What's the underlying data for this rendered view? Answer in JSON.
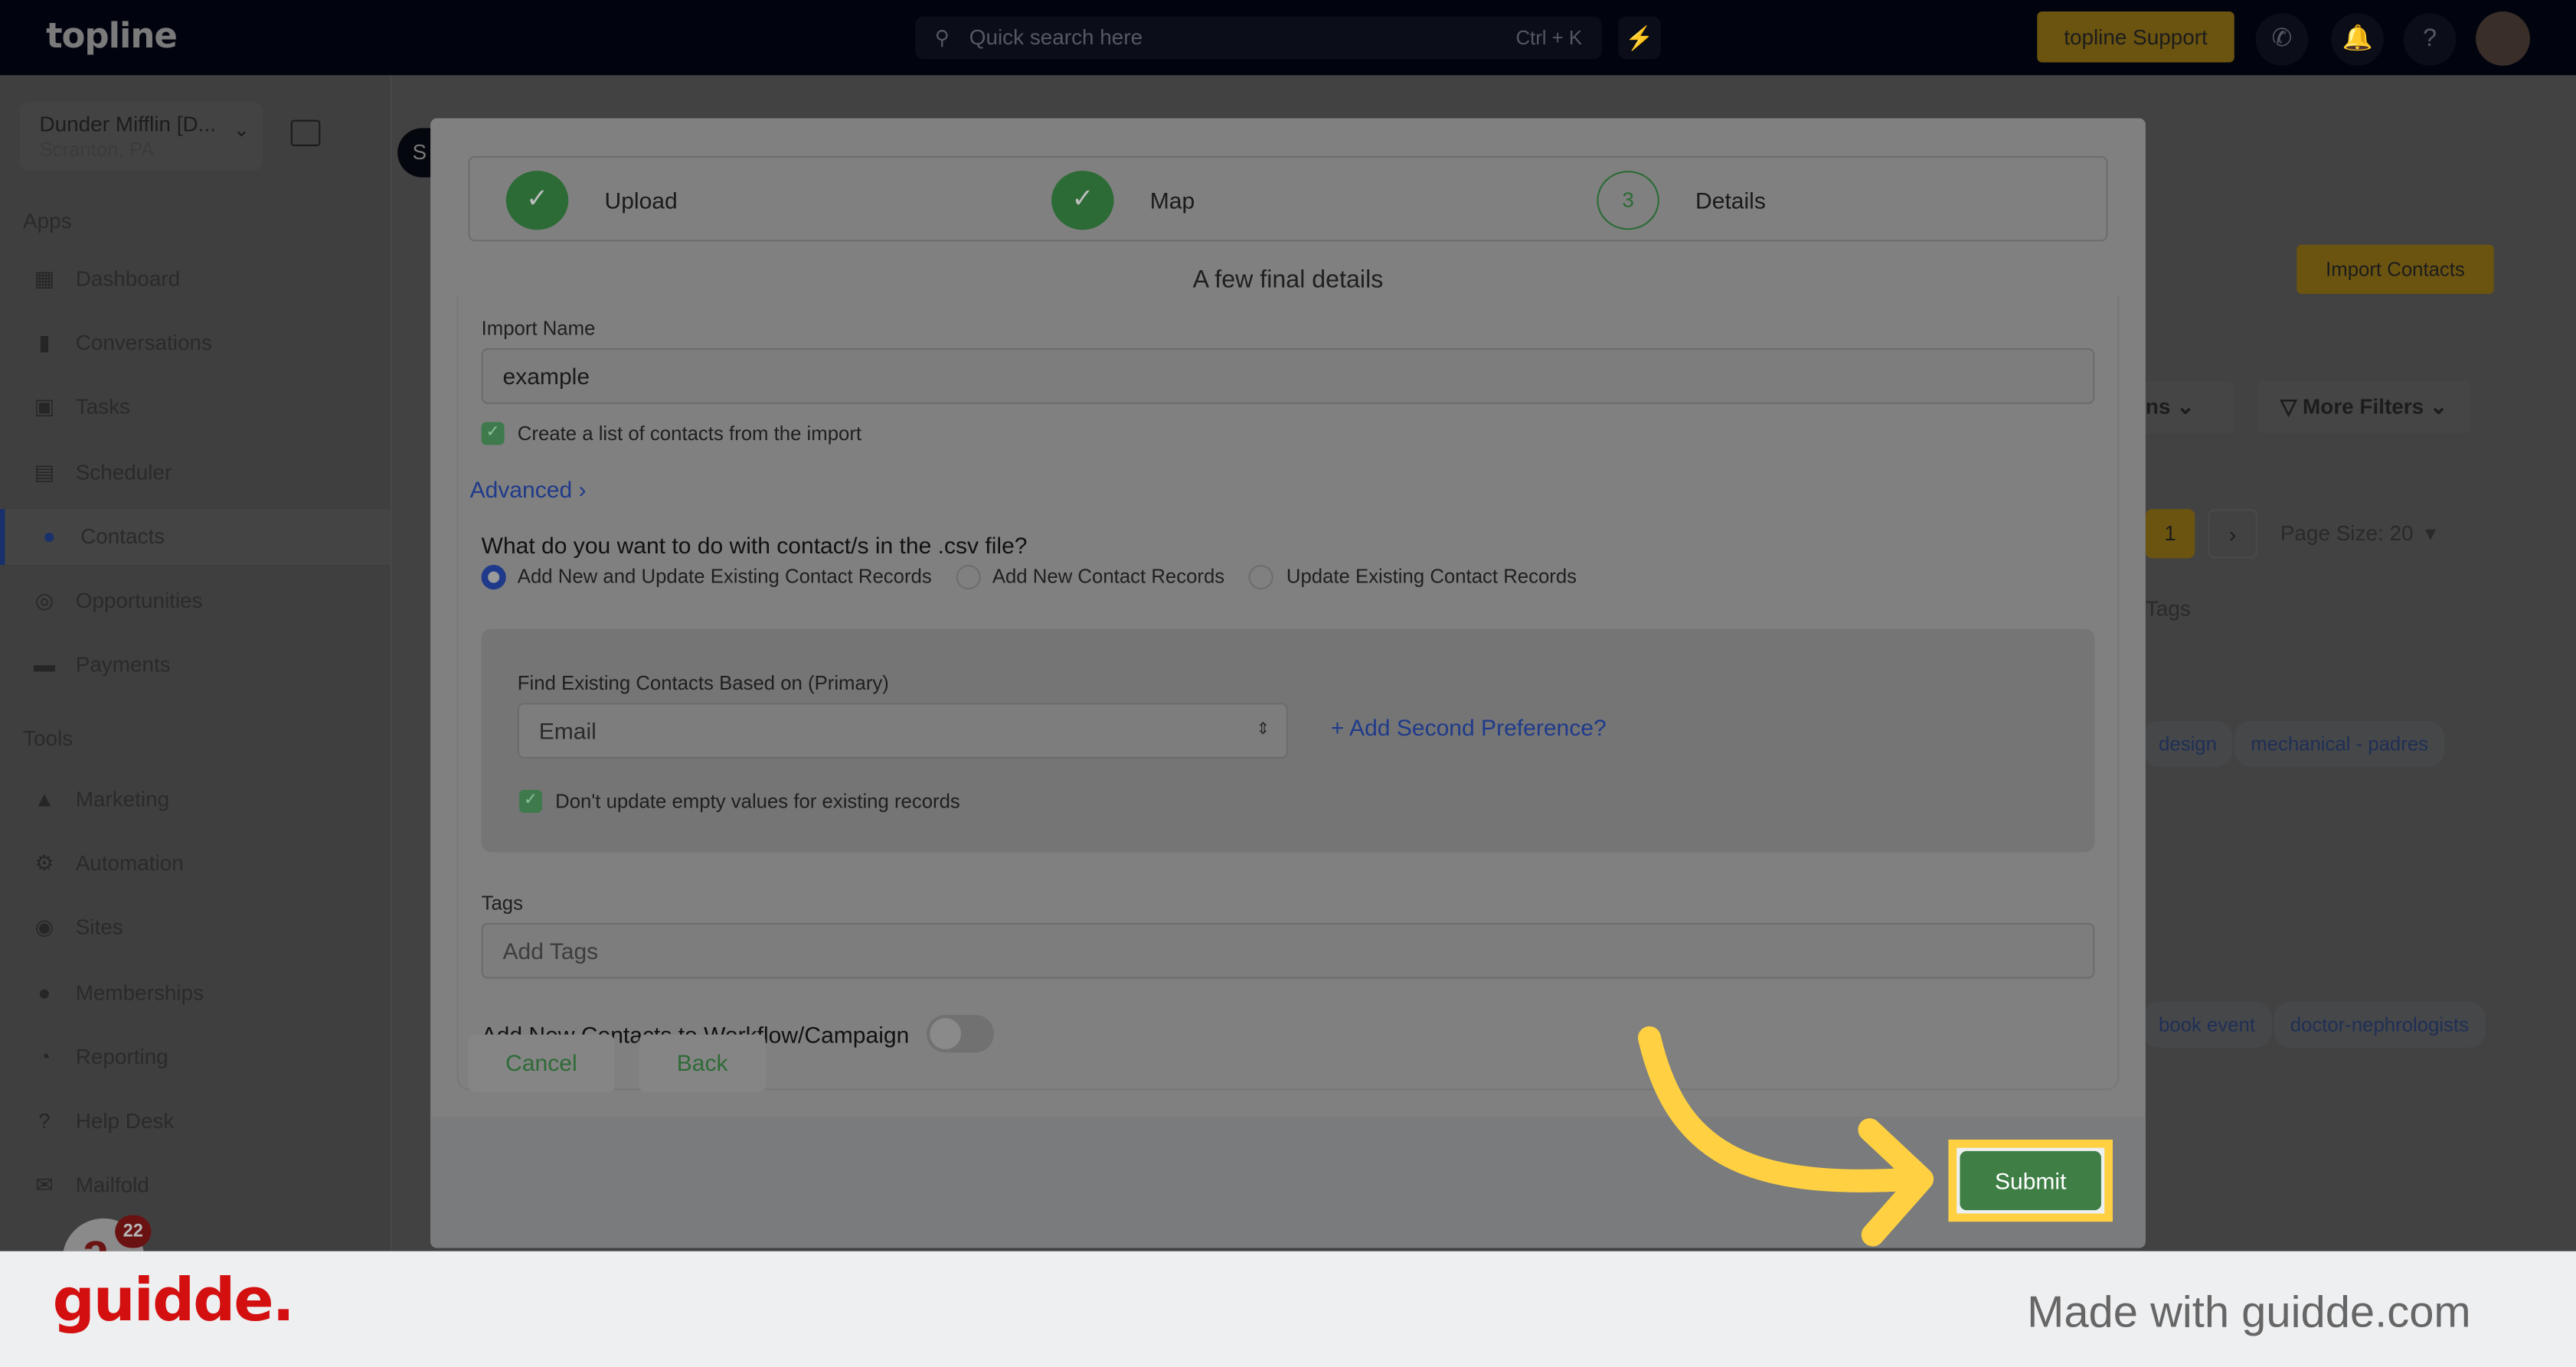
{
  "topbar": {
    "logo": "topline",
    "search_placeholder": "Quick search here",
    "search_shortcut": "Ctrl + K",
    "support_label": "topline Support"
  },
  "sidebar": {
    "account_name": "Dunder Mifflin [D...",
    "account_location": "Scranton, PA",
    "apps_heading": "Apps",
    "apps": [
      {
        "label": "Dashboard",
        "icon": "dashboard-icon"
      },
      {
        "label": "Conversations",
        "icon": "chat-icon"
      },
      {
        "label": "Tasks",
        "icon": "task-icon"
      },
      {
        "label": "Scheduler",
        "icon": "calendar-icon"
      },
      {
        "label": "Contacts",
        "icon": "user-icon",
        "active": true
      },
      {
        "label": "Opportunities",
        "icon": "target-icon"
      },
      {
        "label": "Payments",
        "icon": "card-icon"
      }
    ],
    "tools_heading": "Tools",
    "tools": [
      {
        "label": "Marketing",
        "icon": "megaphone-icon"
      },
      {
        "label": "Automation",
        "icon": "gears-icon"
      },
      {
        "label": "Sites",
        "icon": "globe-icon"
      },
      {
        "label": "Memberships",
        "icon": "users-icon"
      },
      {
        "label": "Reporting",
        "icon": "pie-chart-icon"
      },
      {
        "label": "Help Desk",
        "icon": "help-icon"
      },
      {
        "label": "Mailfold",
        "icon": "mail-icon"
      }
    ],
    "notification_count": "22"
  },
  "background": {
    "import_contacts": "Import Contacts",
    "columns_partial": "ns",
    "more_filters": "More Filters",
    "current_page": "1",
    "page_size": "Page Size: 20",
    "tags_header": "Tags",
    "tags_row1": [
      "design",
      "mechanical - padres"
    ],
    "tags_row2": [
      "book event",
      "doctor-nephrologists"
    ],
    "s_partial": "S"
  },
  "modal": {
    "steps": [
      {
        "label": "Upload",
        "status": "done"
      },
      {
        "label": "Map",
        "status": "done"
      },
      {
        "label": "Details",
        "number": "3",
        "status": "current"
      }
    ],
    "title": "A few final details",
    "import_name_label": "Import Name",
    "import_name_value": "example",
    "create_list_label": "Create a list of contacts from the import",
    "create_list_checked": true,
    "advanced_label": "Advanced",
    "question": "What do you want to do with contact/s in the .csv file?",
    "options": [
      {
        "label": "Add New and Update Existing Contact Records",
        "selected": true
      },
      {
        "label": "Add New Contact Records",
        "selected": false
      },
      {
        "label": "Update Existing Contact Records",
        "selected": false
      }
    ],
    "find_label": "Find Existing Contacts Based on (Primary)",
    "find_value": "Email",
    "add_second_pref": "Add Second Preference?",
    "dont_update_label": "Don't update empty values for existing records",
    "dont_update_checked": true,
    "tags_label": "Tags",
    "tags_placeholder": "Add Tags",
    "workflow_label": "Add New Contacts to Workflow/Campaign",
    "workflow_enabled": false,
    "cancel": "Cancel",
    "back": "Back",
    "submit": "Submit"
  },
  "footer": {
    "brand": "guidde.",
    "made_with": "Made with guidde.com"
  },
  "colors": {
    "accent_green": "#3f7f46",
    "highlight": "#ffd142",
    "link_blue": "#1f3a8a",
    "guidde_red": "#d40f0f"
  }
}
